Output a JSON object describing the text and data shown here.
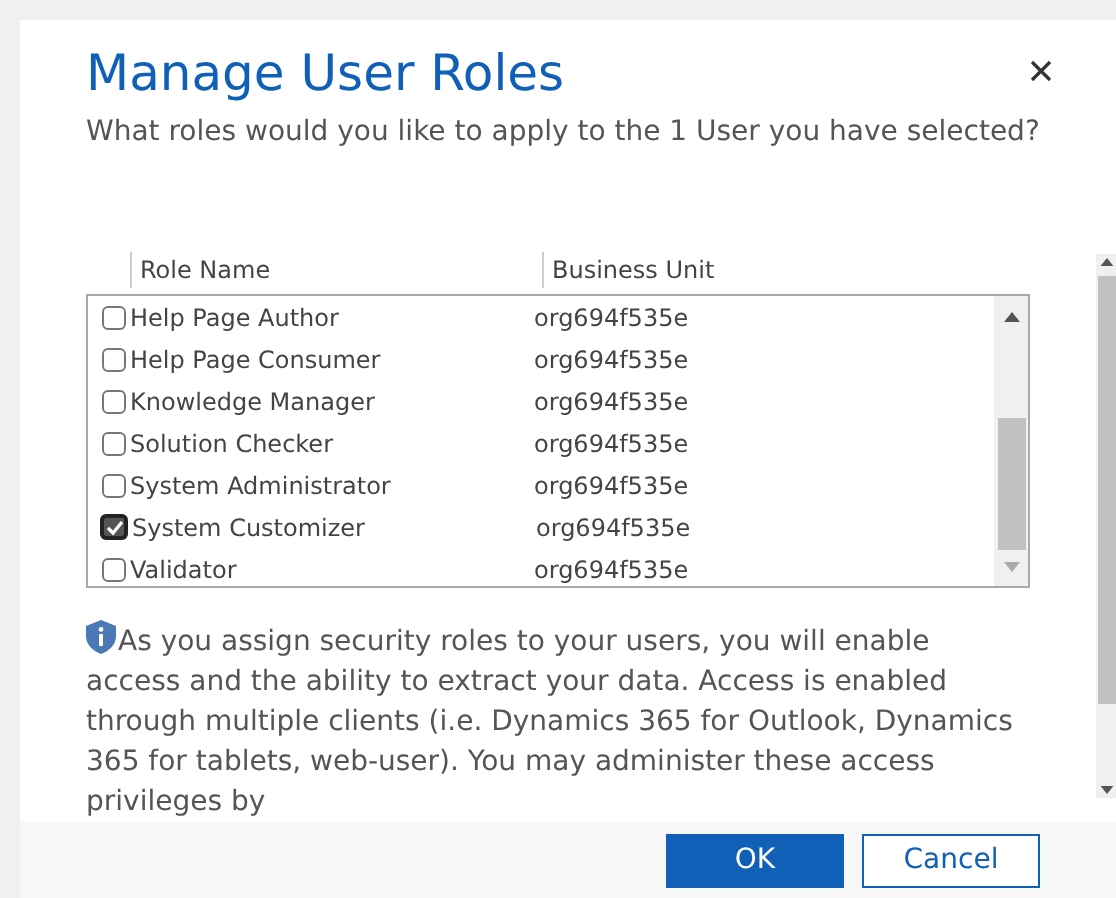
{
  "dialog": {
    "title": "Manage User Roles",
    "subtitle": "What roles would you like to apply to the 1 User you have selected?"
  },
  "table": {
    "columns": [
      "Role Name",
      "Business Unit"
    ],
    "rows": [
      {
        "role": "Help Page Author",
        "unit": "org694f535e",
        "checked": false
      },
      {
        "role": "Help Page Consumer",
        "unit": "org694f535e",
        "checked": false
      },
      {
        "role": "Knowledge Manager",
        "unit": "org694f535e",
        "checked": false
      },
      {
        "role": "Solution Checker",
        "unit": "org694f535e",
        "checked": false
      },
      {
        "role": "System Administrator",
        "unit": "org694f535e",
        "checked": false
      },
      {
        "role": "System Customizer",
        "unit": "org694f535e",
        "checked": true
      },
      {
        "role": "Validator",
        "unit": "org694f535e",
        "checked": false
      }
    ]
  },
  "notice": "As you assign security roles to your users, you will enable access and the ability to extract your data. Access is enabled through multiple clients (i.e. Dynamics 365 for Outlook, Dynamics 365 for tablets, web-user). You may administer these access privileges by",
  "buttons": [
    {
      "label": "OK",
      "kind": "primary"
    },
    {
      "label": "Cancel",
      "kind": "secondary"
    }
  ]
}
